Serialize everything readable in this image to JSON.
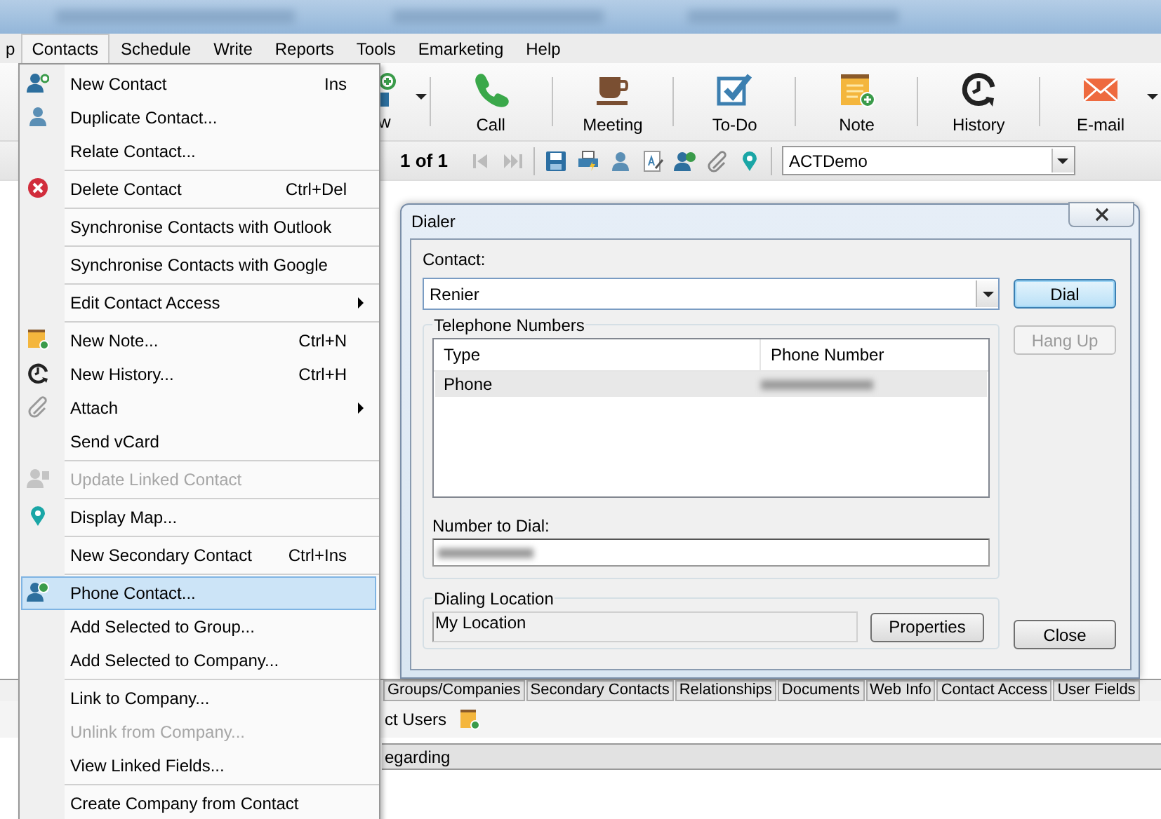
{
  "menu_bar": [
    {
      "label": "p",
      "selected": false
    },
    {
      "label": "Contacts",
      "selected": true
    },
    {
      "label": "Schedule",
      "selected": false
    },
    {
      "label": "Write",
      "selected": false
    },
    {
      "label": "Reports",
      "selected": false
    },
    {
      "label": "Tools",
      "selected": false
    },
    {
      "label": "Emarketing",
      "selected": false
    },
    {
      "label": "Help",
      "selected": false
    }
  ],
  "toolbar": {
    "buttons": [
      {
        "label": "w",
        "dropdown": true
      },
      {
        "label": "Call",
        "dropdown": false
      },
      {
        "label": "Meeting",
        "dropdown": false
      },
      {
        "label": "To-Do",
        "dropdown": false
      },
      {
        "label": "Note",
        "dropdown": false
      },
      {
        "label": "History",
        "dropdown": false
      },
      {
        "label": "E-mail",
        "dropdown": true
      }
    ]
  },
  "record_nav": {
    "position": "1 of 1",
    "database": "ACTDemo"
  },
  "contacts_menu": {
    "groups": [
      [
        {
          "label": "New Contact",
          "shortcut": "Ins",
          "submenu": false,
          "disabled": false,
          "selected": false
        },
        {
          "label": "Duplicate Contact...",
          "submenu": false,
          "disabled": false,
          "selected": false
        },
        {
          "label": "Relate Contact...",
          "submenu": false,
          "disabled": false,
          "selected": false
        }
      ],
      [
        {
          "label": "Delete Contact",
          "shortcut": "Ctrl+Del",
          "submenu": false,
          "disabled": false,
          "selected": false
        }
      ],
      [
        {
          "label": "Synchronise Contacts with Outlook",
          "submenu": false,
          "disabled": false,
          "selected": false
        }
      ],
      [
        {
          "label": "Synchronise Contacts with Google",
          "submenu": false,
          "disabled": false,
          "selected": false
        }
      ],
      [
        {
          "label": "Edit Contact Access",
          "submenu": true,
          "disabled": false,
          "selected": false
        }
      ],
      [
        {
          "label": "New Note...",
          "shortcut": "Ctrl+N",
          "submenu": false,
          "disabled": false,
          "selected": false
        },
        {
          "label": "New History...",
          "shortcut": "Ctrl+H",
          "submenu": false,
          "disabled": false,
          "selected": false
        },
        {
          "label": "Attach",
          "submenu": true,
          "disabled": false,
          "selected": false
        },
        {
          "label": "Send vCard",
          "submenu": false,
          "disabled": false,
          "selected": false
        }
      ],
      [
        {
          "label": "Update Linked Contact",
          "submenu": false,
          "disabled": true,
          "selected": false
        }
      ],
      [
        {
          "label": "Display Map...",
          "submenu": false,
          "disabled": false,
          "selected": false
        }
      ],
      [
        {
          "label": "New Secondary Contact",
          "shortcut": "Ctrl+Ins",
          "submenu": false,
          "disabled": false,
          "selected": false
        }
      ],
      [
        {
          "label": "Phone Contact...",
          "submenu": false,
          "disabled": false,
          "selected": true
        },
        {
          "label": "Add Selected to Group...",
          "submenu": false,
          "disabled": false,
          "selected": false
        },
        {
          "label": "Add Selected to Company...",
          "submenu": false,
          "disabled": false,
          "selected": false
        }
      ],
      [
        {
          "label": "Link to Company...",
          "submenu": false,
          "disabled": false,
          "selected": false
        },
        {
          "label": "Unlink from Company...",
          "submenu": false,
          "disabled": true,
          "selected": false
        },
        {
          "label": "View Linked Fields...",
          "submenu": false,
          "disabled": false,
          "selected": false
        }
      ],
      [
        {
          "label": "Create Company from Contact",
          "submenu": false,
          "disabled": false,
          "selected": false
        }
      ]
    ]
  },
  "dialer": {
    "title": "Dialer",
    "contact_label": "Contact:",
    "contact_value": "Renier",
    "buttons": [
      {
        "label": "Dial",
        "focused": true,
        "disabled": false
      },
      {
        "label": "Hang Up",
        "focused": false,
        "disabled": true
      }
    ],
    "numbers_group": "Telephone Numbers",
    "columns": [
      "Type",
      "Phone Number"
    ],
    "rows": [
      {
        "type": "Phone",
        "selected": true
      }
    ],
    "number_label": "Number to Dial:",
    "location_group": "Dialing Location",
    "location_value": "My Location",
    "properties_button": "Properties",
    "close_button": "Close"
  },
  "detail_tabs": [
    {
      "label": "Groups/Companies"
    },
    {
      "label": "Secondary Contacts"
    },
    {
      "label": "Relationships"
    },
    {
      "label": "Documents"
    },
    {
      "label": "Web Info"
    },
    {
      "label": "Contact Access"
    },
    {
      "label": "User Fields"
    }
  ],
  "detail_row": {
    "label": "ct Users"
  },
  "grid_header": {
    "column": "egarding"
  }
}
